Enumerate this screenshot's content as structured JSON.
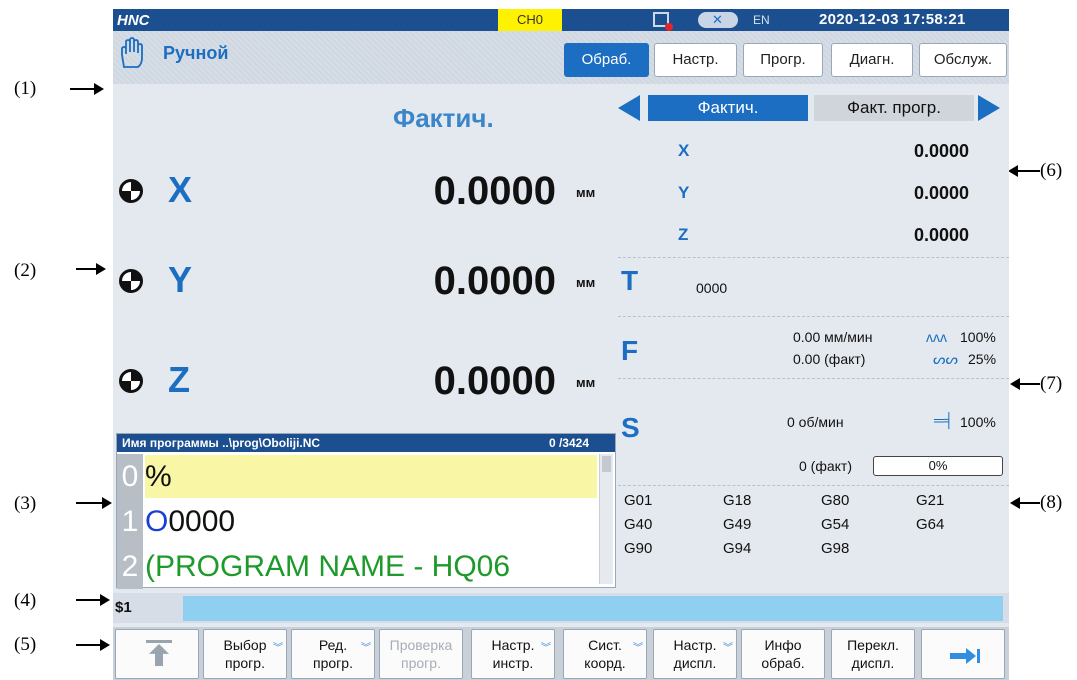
{
  "callouts": [
    "(1)",
    "(2)",
    "(3)",
    "(4)",
    "(5)",
    "(6)",
    "(7)",
    "(8)"
  ],
  "status": {
    "channel": "CH0",
    "language": "EN",
    "datetime": "2020-12-03 17:58:21",
    "net_icon": "network-error-icon",
    "close_icon": "close-icon"
  },
  "header": {
    "mode": "Ручной",
    "mode_icon": "hand-icon",
    "tabs": [
      "Обраб.",
      "Настр.",
      "Прогр.",
      "Диагн.",
      "Обслуж."
    ],
    "active_tab": "Обраб."
  },
  "main": {
    "title": "Фактич.",
    "axes": [
      {
        "name": "X",
        "value": "0.0000",
        "unit": "мм"
      },
      {
        "name": "Y",
        "value": "0.0000",
        "unit": "мм"
      },
      {
        "name": "Z",
        "value": "0.0000",
        "unit": "мм"
      }
    ]
  },
  "program": {
    "header": "Имя программы   ..\\prog\\Oboliji.NC",
    "count": "0  /3424",
    "lines": [
      {
        "no": "0",
        "text": "%"
      },
      {
        "no": "1",
        "text": "O0000"
      },
      {
        "no": "2",
        "text": "(PROGRAM NAME - HQ06"
      }
    ]
  },
  "right": {
    "tab_active": "Фактич.",
    "tab_other": "Факт. прогр.",
    "axes": [
      {
        "name": "X",
        "value": "0.0000"
      },
      {
        "name": "Y",
        "value": "0.0000"
      },
      {
        "name": "Z",
        "value": "0.0000"
      }
    ],
    "t_label": "T",
    "t_value": "0000",
    "f_label": "F",
    "f_line1": "0.00 мм/мин",
    "f_pct1": "100%",
    "f_line2": "0.00 (факт)",
    "f_pct2": "25%",
    "s_label": "S",
    "s_line1": "0 об/мин",
    "s_pct1": "100%",
    "s_line2": "0 (факт)",
    "s_bar": "0%",
    "gcodes": [
      "G01",
      "G18",
      "G80",
      "G21",
      "G40",
      "G49",
      "G54",
      "G64",
      "G90",
      "G94",
      "G98"
    ]
  },
  "cmd": {
    "label": "$1",
    "value": ""
  },
  "softkeys": [
    {
      "l1": "",
      "l2": "",
      "icon": "back-to-top-icon"
    },
    {
      "l1": "Выбор",
      "l2": "прогр."
    },
    {
      "l1": "Ред.",
      "l2": "прогр."
    },
    {
      "l1": "Проверка",
      "l2": "прогр.",
      "disabled": true
    },
    {
      "l1": "Настр.",
      "l2": "инстр."
    },
    {
      "l1": "Сист.",
      "l2": "коорд."
    },
    {
      "l1": "Настр.",
      "l2": "диспл."
    },
    {
      "l1": "Инфо",
      "l2": "обраб."
    },
    {
      "l1": "Перекл.",
      "l2": "диспл."
    },
    {
      "l1": "",
      "l2": "",
      "icon": "next-page-icon"
    }
  ]
}
